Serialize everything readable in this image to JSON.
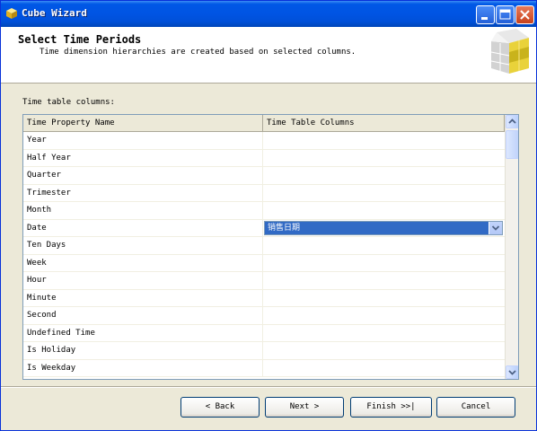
{
  "window": {
    "title": "Cube Wizard",
    "icon": "cube-icon",
    "controls": [
      "minimize-icon",
      "maximize-icon",
      "close-icon"
    ]
  },
  "header": {
    "title": "Select Time Periods",
    "subtitle": "Time dimension hierarchies are created based on selected columns."
  },
  "table": {
    "label": "Time table columns:",
    "columns": [
      "Time Property Name",
      "Time Table Columns"
    ],
    "rows": [
      {
        "property": "Year",
        "column": ""
      },
      {
        "property": "Half Year",
        "column": ""
      },
      {
        "property": "Quarter",
        "column": ""
      },
      {
        "property": "Trimester",
        "column": ""
      },
      {
        "property": "Month",
        "column": ""
      },
      {
        "property": "Date",
        "column": "销售日期"
      },
      {
        "property": "Ten Days",
        "column": ""
      },
      {
        "property": "Week",
        "column": ""
      },
      {
        "property": "Hour",
        "column": ""
      },
      {
        "property": "Minute",
        "column": ""
      },
      {
        "property": "Second",
        "column": ""
      },
      {
        "property": "Undefined Time",
        "column": ""
      },
      {
        "property": "Is Holiday",
        "column": ""
      },
      {
        "property": "Is Weekday",
        "column": ""
      }
    ],
    "selected_row": 5
  },
  "buttons": {
    "back": "< Back",
    "next": "Next >",
    "finish": "Finish >>|",
    "cancel": "Cancel"
  },
  "colors": {
    "title_bar": "#0054e3",
    "selection": "#316ac5",
    "dialog_bg": "#ece9d8"
  }
}
